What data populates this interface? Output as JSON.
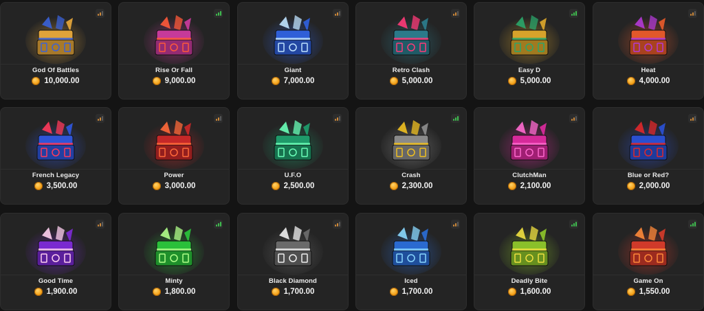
{
  "cases": [
    {
      "name": "God Of Battles",
      "price": "10,000.00",
      "theme": "#e0a33a",
      "accent": "#3a62d8",
      "indicator": "orange"
    },
    {
      "name": "Rise Or Fall",
      "price": "9,000.00",
      "theme": "#c63a9a",
      "accent": "#ff5a3a",
      "indicator": "green"
    },
    {
      "name": "Giant",
      "price": "7,000.00",
      "theme": "#2f5fd8",
      "accent": "#bfe3ff",
      "indicator": "orange"
    },
    {
      "name": "Retro Clash",
      "price": "5,000.00",
      "theme": "#2b7a8a",
      "accent": "#ff3a78",
      "indicator": "orange"
    },
    {
      "name": "Easy D",
      "price": "5,000.00",
      "theme": "#d7a32b",
      "accent": "#2aa66a",
      "indicator": "green"
    },
    {
      "name": "Heat",
      "price": "4,000.00",
      "theme": "#e2582a",
      "accent": "#b23ad6",
      "indicator": "orange"
    },
    {
      "name": "French Legacy",
      "price": "3,500.00",
      "theme": "#2f55d8",
      "accent": "#ff3a5a",
      "indicator": "orange"
    },
    {
      "name": "Power",
      "price": "3,000.00",
      "theme": "#c52828",
      "accent": "#ff6a3a",
      "indicator": "orange"
    },
    {
      "name": "U.F.O",
      "price": "2,500.00",
      "theme": "#1f9a6a",
      "accent": "#6affb8",
      "indicator": "orange"
    },
    {
      "name": "Crash",
      "price": "2,300.00",
      "theme": "#8a8a8a",
      "accent": "#f0c020",
      "indicator": "green"
    },
    {
      "name": "ClutchMan",
      "price": "2,100.00",
      "theme": "#d62a9a",
      "accent": "#ff6ad0",
      "indicator": "orange"
    },
    {
      "name": "Blue or Red?",
      "price": "2,000.00",
      "theme": "#2a4fd0",
      "accent": "#e0282a",
      "indicator": "orange"
    },
    {
      "name": "Good Time",
      "price": "1,900.00",
      "theme": "#7a2ad0",
      "accent": "#ffd0f0",
      "indicator": "orange"
    },
    {
      "name": "Minty",
      "price": "1,800.00",
      "theme": "#2ac03a",
      "accent": "#b0ff8a",
      "indicator": "green"
    },
    {
      "name": "Black Diamond",
      "price": "1,700.00",
      "theme": "#6a6a6a",
      "accent": "#f0f0f0",
      "indicator": "orange"
    },
    {
      "name": "Iced",
      "price": "1,700.00",
      "theme": "#2a6ad0",
      "accent": "#8ad8ff",
      "indicator": "orange"
    },
    {
      "name": "Deadly Bite",
      "price": "1,600.00",
      "theme": "#8ac02a",
      "accent": "#f0e040",
      "indicator": "green"
    },
    {
      "name": "Game On",
      "price": "1,550.00",
      "theme": "#d03a2a",
      "accent": "#ff8a3a",
      "indicator": "green"
    }
  ],
  "indicator_colors": {
    "green": "#3fbf4f",
    "orange": "#d08a3a",
    "dim": "#5a5a5a"
  }
}
